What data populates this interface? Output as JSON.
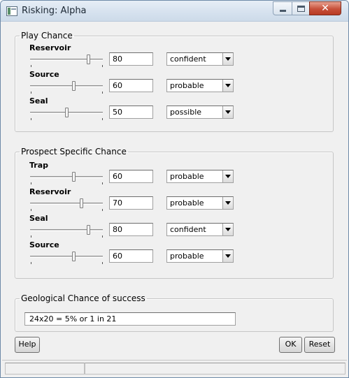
{
  "window": {
    "title": "Risking: Alpha",
    "close_label": "✕"
  },
  "play_chance": {
    "legend": "Play Chance",
    "rows": [
      {
        "label": "Reservoir",
        "value": "80",
        "level": "confident",
        "slider_fraction": 0.8
      },
      {
        "label": "Source",
        "value": "60",
        "level": "probable",
        "slider_fraction": 0.6
      },
      {
        "label": "Seal",
        "value": "50",
        "level": "possible",
        "slider_fraction": 0.5
      }
    ]
  },
  "prospect_chance": {
    "legend": "Prospect Specific Chance",
    "rows": [
      {
        "label": "Trap",
        "value": "60",
        "level": "probable",
        "slider_fraction": 0.6
      },
      {
        "label": "Reservoir",
        "value": "70",
        "level": "probable",
        "slider_fraction": 0.7
      },
      {
        "label": "Seal",
        "value": "80",
        "level": "confident",
        "slider_fraction": 0.8
      },
      {
        "label": "Source",
        "value": "60",
        "level": "probable",
        "slider_fraction": 0.6
      }
    ]
  },
  "geological": {
    "legend": "Geological Chance of success",
    "result": "24x20 = 5% or 1 in 21"
  },
  "buttons": {
    "help": "Help",
    "ok": "OK",
    "reset": "Reset"
  },
  "icons": {
    "app": "app-window-icon",
    "minimize": "minimize-icon",
    "maximize": "maximize-icon",
    "close": "close-icon",
    "dropdown": "chevron-down-icon"
  }
}
